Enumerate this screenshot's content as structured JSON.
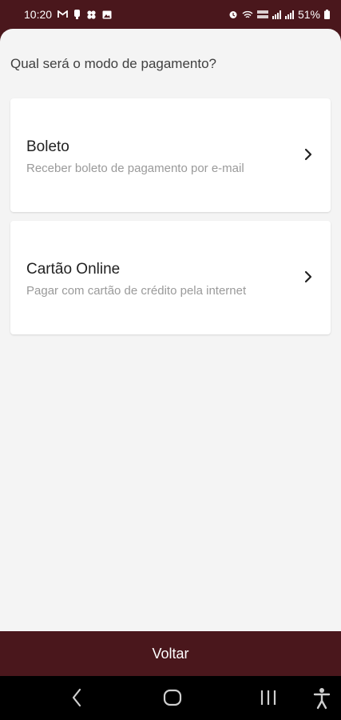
{
  "status_bar": {
    "time": "10:20",
    "battery": "51%",
    "left_icons": [
      "gmail-icon",
      "notification-icon",
      "app-icon",
      "image-icon"
    ],
    "right_icons": [
      "alarm-icon",
      "wifi-icon",
      "volte-icon",
      "signal-icon",
      "signal-icon",
      "battery-icon"
    ]
  },
  "sheet": {
    "prompt": "Qual será o modo de pagamento?",
    "options": [
      {
        "title": "Boleto",
        "subtitle": "Receber boleto de pagamento por e-mail"
      },
      {
        "title": "Cartão Online",
        "subtitle": "Pagar com cartão de crédito pela internet"
      }
    ]
  },
  "footer": {
    "back_label": "Voltar"
  },
  "nav_bar": {
    "buttons": [
      "back-icon",
      "home-icon",
      "recents-icon",
      "accessibility-icon"
    ]
  },
  "colors": {
    "brand": "#4a171c",
    "background": "#f4f4f4",
    "card": "#ffffff"
  }
}
